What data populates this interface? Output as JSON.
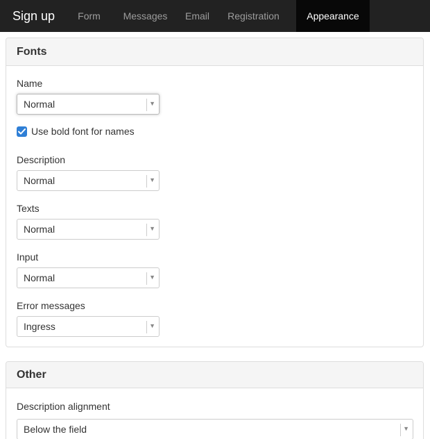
{
  "navbar": {
    "brand": "Sign up",
    "tabs": [
      {
        "label": "Form",
        "active": false
      },
      {
        "label": "Messages",
        "active": false
      },
      {
        "label": "Email",
        "active": false
      },
      {
        "label": "Registration",
        "active": false
      },
      {
        "label": "Appearance",
        "active": true
      }
    ]
  },
  "fonts": {
    "title": "Fonts",
    "name_label": "Name",
    "name_value": "Normal",
    "bold_checkbox_label": "Use bold font for names",
    "bold_checked": true,
    "description_label": "Description",
    "description_value": "Normal",
    "texts_label": "Texts",
    "texts_value": "Normal",
    "input_label": "Input",
    "input_value": "Normal",
    "error_label": "Error messages",
    "error_value": "Ingress"
  },
  "other": {
    "title": "Other",
    "alignment_label": "Description alignment",
    "alignment_value": "Below the field"
  },
  "colors": {
    "navbar_bg": "#222222",
    "active_tab_bg": "#080808",
    "checkbox_accent": "#2f7fd6"
  }
}
